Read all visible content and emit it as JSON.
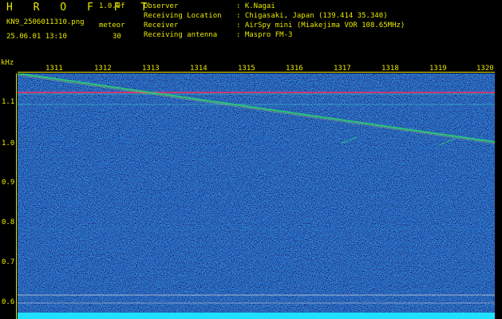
{
  "header": {
    "title": "H R O F F T",
    "version": "1.0.0f",
    "file": "KN9_2506011310.png",
    "timestamp": "25.06.01 13:10",
    "meteor_label": "meteor",
    "meteor_count": "30"
  },
  "info": [
    {
      "key": "Observer",
      "value": ": K.Nagai"
    },
    {
      "key": "Receiving Location",
      "value": ": Chigasaki, Japan (139.414 35.340)"
    },
    {
      "key": "Receiver",
      "value": ": AirSpy mini (Miakejima VOR 108.65MHz)"
    },
    {
      "key": "Receiving antenna",
      "value": ": Maspro FM-3"
    }
  ],
  "axes": {
    "unit": "kHz",
    "y_ticks": [
      "1.1",
      "1.0",
      "0.9",
      "0.8",
      "0.7",
      "0.6"
    ],
    "x_ticks": [
      "1311",
      "1312",
      "1313",
      "1314",
      "1315",
      "1316",
      "1317",
      "1318",
      "1319",
      "1320"
    ]
  },
  "colors": {
    "label": "#e8e800",
    "background_noise": "#101c8a",
    "carrier": "#e83070",
    "echo": "#30d070",
    "baseline": "#20e0ff"
  }
}
